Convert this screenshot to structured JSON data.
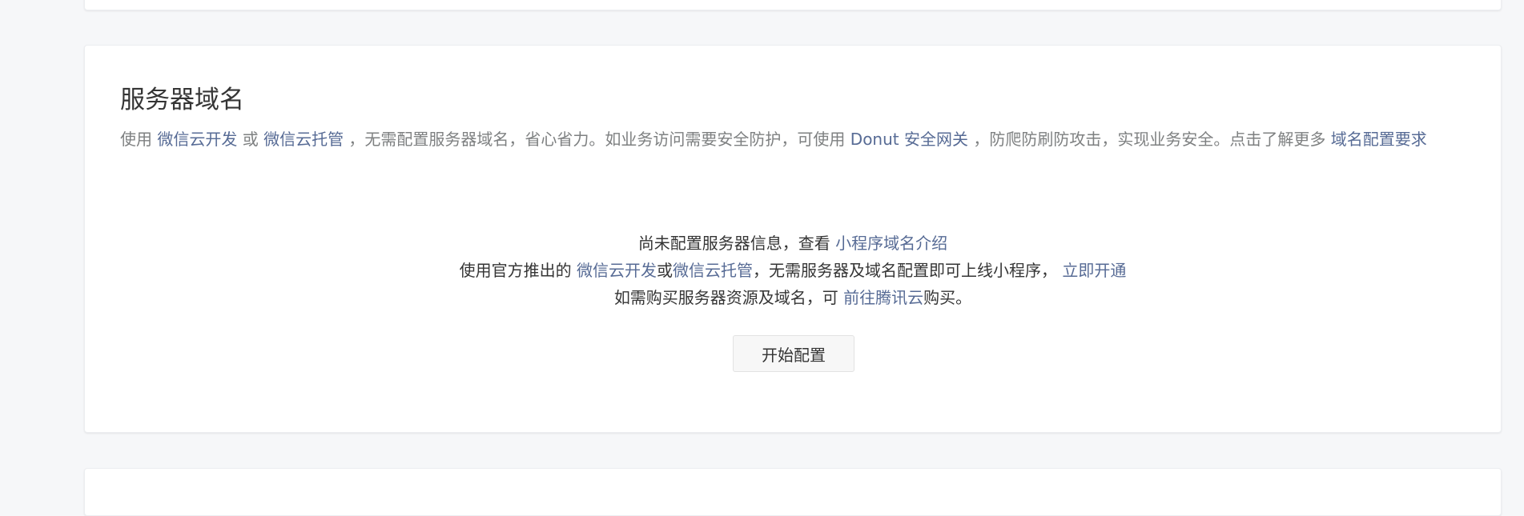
{
  "section": {
    "title": "服务器域名",
    "desc": {
      "p1": "使用 ",
      "link_cloud_dev": "微信云开发",
      "p2": " 或 ",
      "link_cloud_host": "微信云托管",
      "p3": " ，无需配置服务器域名，省心省力。如业务访问需要安全防护，可使用 ",
      "link_donut": "Donut 安全网关",
      "p4": " ，防爬防刷防攻击，实现业务安全。点击了解更多 ",
      "link_requirements": "域名配置要求"
    }
  },
  "empty": {
    "line1_text": "尚未配置服务器信息，查看 ",
    "line1_link": "小程序域名介绍",
    "line2_text_a": "使用官方推出的 ",
    "line2_link_dev": "微信云开发",
    "line2_or": "或",
    "line2_link_host": "微信云托管",
    "line2_text_b": "，无需服务器及域名配置即可上线小程序， ",
    "line2_link_open": "立即开通",
    "line3_text_a": "如需购买服务器资源及域名，可 ",
    "line3_link": "前往腾讯云",
    "line3_text_b": "购买。"
  },
  "button": {
    "start_config": "开始配置"
  }
}
